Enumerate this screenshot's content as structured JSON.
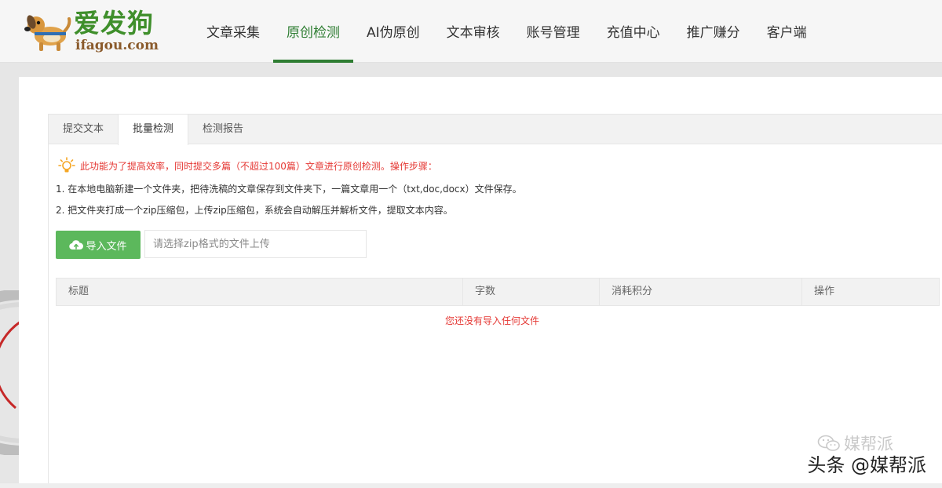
{
  "brand": {
    "name_cn": "爱发狗",
    "domain": "ifagou.com",
    "colors": {
      "green": "#3f8f2b",
      "brown": "#8a5a2b"
    }
  },
  "nav": {
    "items": [
      {
        "label": "文章采集",
        "active": false
      },
      {
        "label": "原创检测",
        "active": true
      },
      {
        "label": "AI伪原创",
        "active": false
      },
      {
        "label": "文本审核",
        "active": false
      },
      {
        "label": "账号管理",
        "active": false
      },
      {
        "label": "充值中心",
        "active": false
      },
      {
        "label": "推广赚分",
        "active": false
      },
      {
        "label": "客户端",
        "active": false
      }
    ],
    "active_color": "#2e7d32"
  },
  "tabs": [
    {
      "label": "提交文本",
      "active": false
    },
    {
      "label": "批量检测",
      "active": true
    },
    {
      "label": "检测报告",
      "active": false
    }
  ],
  "tip": {
    "icon": "lightbulb-icon",
    "text": "此功能为了提高效率，同时提交多篇（不超过100篇）文章进行原创检测。操作步骤：",
    "color": "#e53935"
  },
  "steps": [
    "1. 在本地电脑新建一个文件夹，把待洗稿的文章保存到文件夹下，一篇文章用一个（txt,doc,docx）文件保存。",
    "2. 把文件夹打成一个zip压缩包，上传zip压缩包，系统会自动解压并解析文件，提取文本内容。"
  ],
  "upload": {
    "button_label": "导入文件",
    "icon": "cloud-upload-icon",
    "input_placeholder": "请选择zip格式的文件上传",
    "input_value": "",
    "button_color": "#5cb85c"
  },
  "table": {
    "columns": [
      "标题",
      "字数",
      "消耗积分",
      "操作"
    ],
    "rows": [],
    "empty_text": "您还没有导入任何文件"
  },
  "watermark": {
    "account": "媒帮派",
    "platform_line": "头条 @媒帮派",
    "icon": "wechat-icon"
  }
}
